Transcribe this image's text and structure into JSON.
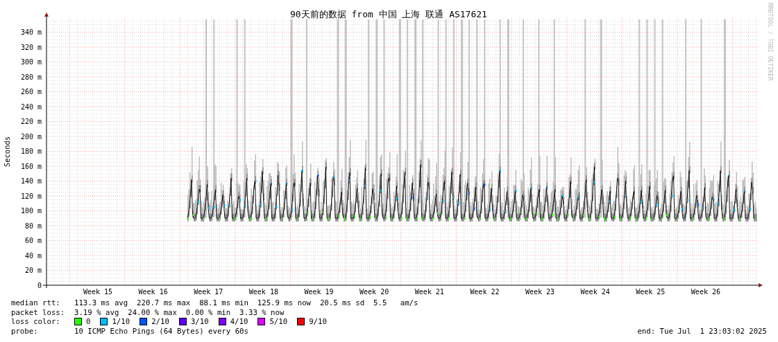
{
  "title": "90天前的数据 from 中国 上海 联通 AS17621",
  "credit": "RRDTOOL / TOBI OETIKER",
  "chart": {
    "ylabel": "Seconds",
    "yticks": [
      "340 m",
      "320 m",
      "300 m",
      "280 m",
      "260 m",
      "240 m",
      "220 m",
      "200 m",
      "180 m",
      "160 m",
      "140 m",
      "120 m",
      "100 m",
      "80 m",
      "60 m",
      "40 m",
      "20 m",
      "0"
    ],
    "xticks": [
      "Week 15",
      "Week 16",
      "Week 17",
      "Week 18",
      "Week 19",
      "Week 20",
      "Week 21",
      "Week 22",
      "Week 23",
      "Week 24",
      "Week 25",
      "Week 26"
    ]
  },
  "legend": {
    "median_rtt": {
      "label": "median rtt:",
      "text": "113.3 ms avg  220.7 ms max  88.1 ms min  125.9 ms now  20.5 ms sd  5.5   am/s"
    },
    "packet_loss": {
      "label": "packet loss:",
      "text": "3.19 % avg  24.00 % max  0.00 % min  3.33 % now"
    },
    "loss_color": {
      "label": "loss color:",
      "items": [
        {
          "label": "0",
          "color": "#26ff00"
        },
        {
          "label": "1/10",
          "color": "#00b8ff"
        },
        {
          "label": "2/10",
          "color": "#0059ff"
        },
        {
          "label": "3/10",
          "color": "#5e00ff"
        },
        {
          "label": "4/10",
          "color": "#7e00ff"
        },
        {
          "label": "5/10",
          "color": "#dd00ff"
        },
        {
          "label": "9/10",
          "color": "#ff0000"
        }
      ]
    },
    "probe": {
      "label": "probe:",
      "text": "10 ICMP Echo Pings (64 Bytes) every 60s"
    },
    "end": "end: Tue Jul  1 23:03:02 2025"
  }
}
